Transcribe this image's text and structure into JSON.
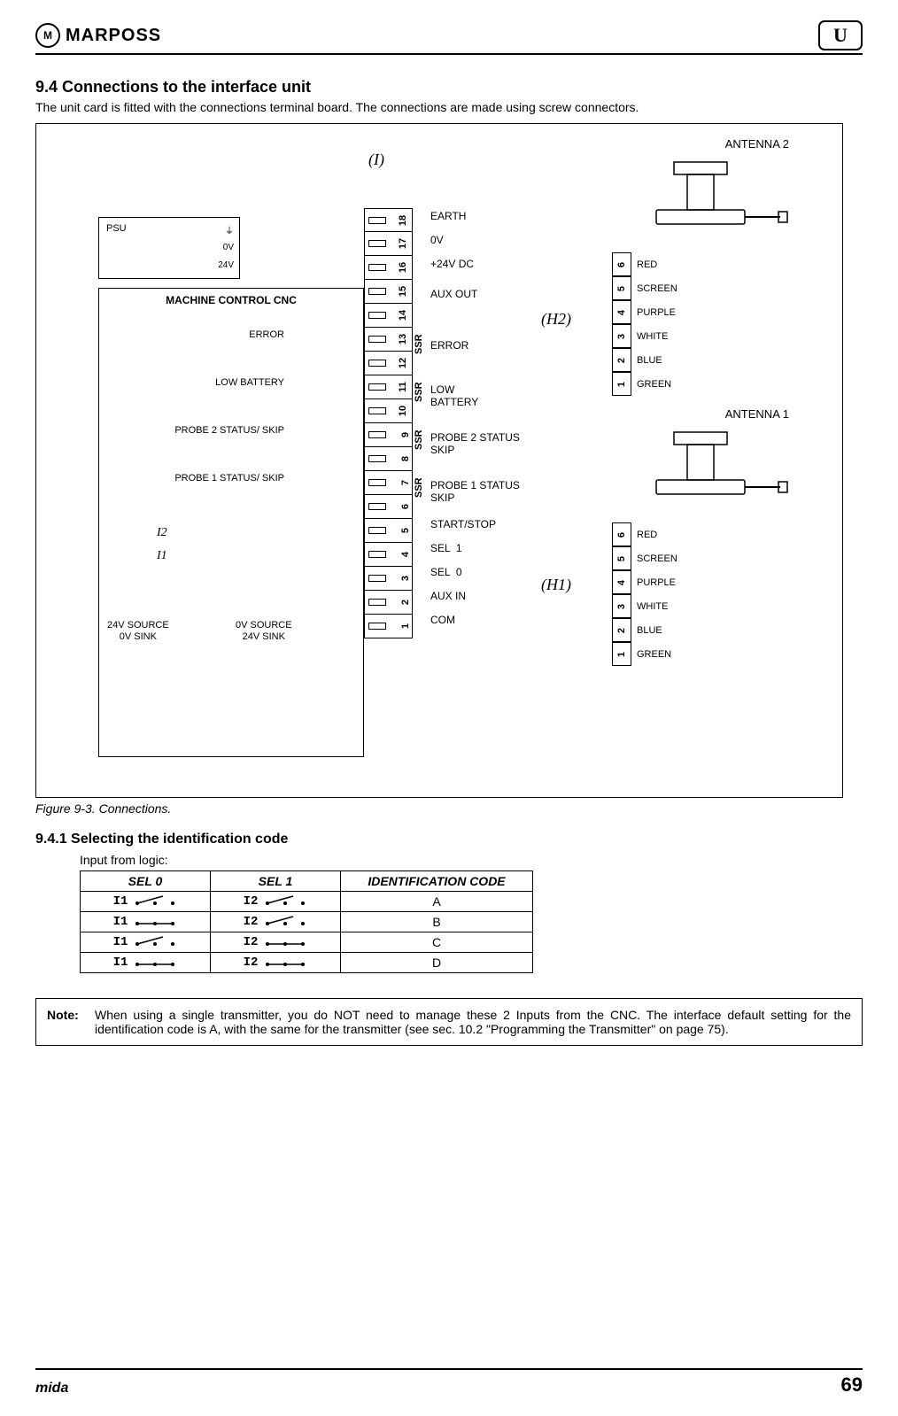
{
  "header": {
    "brand": "MARPOSS",
    "brand_circle": "M",
    "badge": "U"
  },
  "section": {
    "num_title": "9.4 Connections to the interface unit",
    "intro": "The unit card is fitted with the connections terminal board. The connections are made using screw connectors."
  },
  "figure": {
    "caption": "Figure 9-3. Connections.",
    "tags": {
      "I": "(I)",
      "H1": "(H1)",
      "H2": "(H2)"
    },
    "psu": {
      "label": "PSU",
      "earth_sym": "⏚",
      "v0": "0V",
      "v24": "24V"
    },
    "cnc": {
      "title": "MACHINE CONTROL CNC",
      "signals_left": {
        "error": "ERROR",
        "low_batt": "LOW BATTERY",
        "p2": "PROBE 2 STATUS/ SKIP",
        "p1": "PROBE 1 STATUS/ SKIP"
      },
      "i2": "I2",
      "i1": "I1",
      "src_a": "24V SOURCE\n0V SINK",
      "src_b": "0V SOURCE\n24V SINK"
    },
    "terminals": {
      "18": "EARTH",
      "17": "0V",
      "16": "+24V DC",
      "15": "",
      "14": "AUX OUT",
      "13": "",
      "12": "ERROR",
      "11": "",
      "10": "LOW\nBATTERY",
      "9": "",
      "8": "PROBE 2 STATUS\nSKIP",
      "7": "",
      "6": "PROBE 1 STATUS\nSKIP",
      "5": "START/STOP",
      "4": "SEL  1",
      "3": "SEL  0",
      "2": "AUX IN",
      "1": "COM"
    },
    "ssr": "SSR",
    "antennas": {
      "a2": "ANTENNA 2",
      "a1": "ANTENNA 1"
    },
    "colors": {
      "6": "RED",
      "5": "SCREEN",
      "4": "PURPLE",
      "3": "WHITE",
      "2": "BLUE",
      "1": "GREEN"
    }
  },
  "subsection": {
    "title": "9.4.1     Selecting the identification code",
    "input_from_logic": "Input from logic:",
    "table": {
      "head": {
        "c0": "SEL 0",
        "c1": "SEL 1",
        "c2": "IDENTIFICATION CODE"
      },
      "rows": [
        {
          "i1": "I1",
          "i1_closed": false,
          "i2": "I2",
          "i2_closed": false,
          "code": "A"
        },
        {
          "i1": "I1",
          "i1_closed": true,
          "i2": "I2",
          "i2_closed": false,
          "code": "B"
        },
        {
          "i1": "I1",
          "i1_closed": false,
          "i2": "I2",
          "i2_closed": true,
          "code": "C"
        },
        {
          "i1": "I1",
          "i1_closed": true,
          "i2": "I2",
          "i2_closed": true,
          "code": "D"
        }
      ]
    }
  },
  "note": {
    "label": "Note:",
    "text": "When using a single transmitter, you do NOT need to manage these 2 Inputs from the CNC. The interface default setting for the identification code is A, with the same for the transmitter (see sec. 10.2 \"Programming the Transmitter\" on page 75)."
  },
  "footer": {
    "left": "mida",
    "right": "69"
  }
}
